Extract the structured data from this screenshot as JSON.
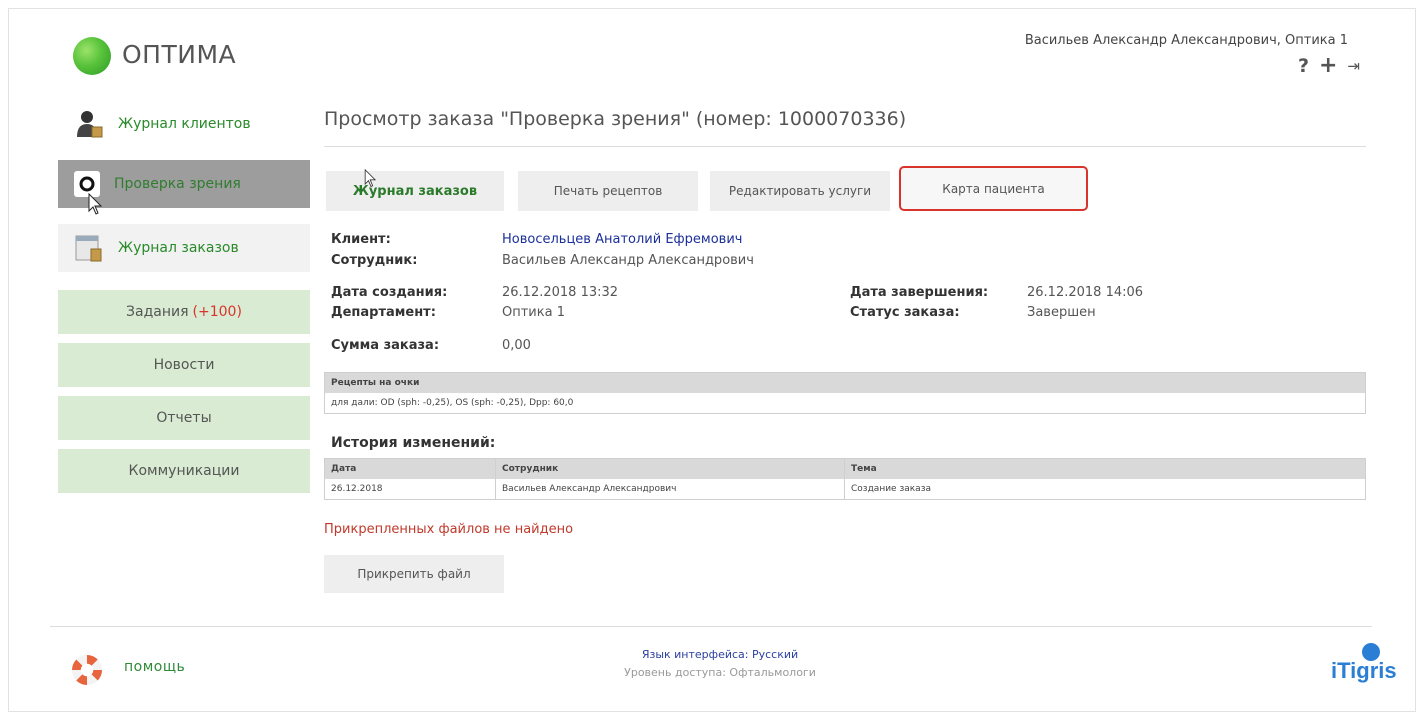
{
  "app": {
    "logo_text": "ОПТИМА"
  },
  "header": {
    "user": "Васильев Александр Александрович, Оптика 1",
    "icons": [
      "help-icon",
      "plus-icon",
      "logout-icon"
    ],
    "help_glyph": "?",
    "plus_glyph": "+",
    "logout_glyph": "⇥"
  },
  "sidebar": {
    "items": [
      {
        "label": "Журнал клиентов",
        "icon": "clients-icon"
      },
      {
        "label": "Проверка зрения",
        "icon": "vision-check-icon"
      },
      {
        "label": "Журнал заказов",
        "icon": "orders-icon"
      }
    ],
    "green_items": [
      {
        "label": "Задания",
        "badge": "(+100)"
      },
      {
        "label": "Новости"
      },
      {
        "label": "Отчеты"
      },
      {
        "label": "Коммуникации"
      }
    ]
  },
  "main": {
    "title": "Просмотр заказа \"Проверка зрения\" (номер: 1000070336)",
    "tabs": [
      {
        "label": "Журнал заказов"
      },
      {
        "label": "Печать рецептов"
      },
      {
        "label": "Редактировать услуги"
      },
      {
        "label": "Карта пациента"
      }
    ],
    "fields": {
      "client_label": "Клиент:",
      "client_value": "Новосельцев Анатолий Ефремович",
      "employee_label": "Сотрудник:",
      "employee_value": "Васильев Александр Александрович",
      "created_label": "Дата создания:",
      "created_value": "26.12.2018 13:32",
      "department_label": "Департамент:",
      "department_value": "Оптика 1",
      "completed_label": "Дата завершения:",
      "completed_value": "26.12.2018 14:06",
      "status_label": "Статус заказа:",
      "status_value": "Завершен",
      "sum_label": "Сумма заказа:",
      "sum_value": "0,00"
    },
    "prescriptions": {
      "header": "Рецепты на очки",
      "row": "для дали: OD (sph: -0,25), OS (sph: -0,25), Dpp: 60,0"
    },
    "history": {
      "title": "История изменений:",
      "columns": [
        "Дата",
        "Сотрудник",
        "Тема"
      ],
      "rows": [
        [
          "26.12.2018",
          "Васильев Александр Александрович",
          "Создание заказа"
        ]
      ]
    },
    "no_files": "Прикрепленных файлов не найдено",
    "attach_label": "Прикрепить файл"
  },
  "footer": {
    "help": "помощь",
    "language": "Язык интерфейса: Русский",
    "access": "Уровень доступа: Офтальмологи",
    "brand": "iTigris"
  },
  "colors": {
    "accent_green": "#2a8a2a",
    "highlight_red": "#d9342b",
    "link_blue": "#1b2f9a"
  }
}
